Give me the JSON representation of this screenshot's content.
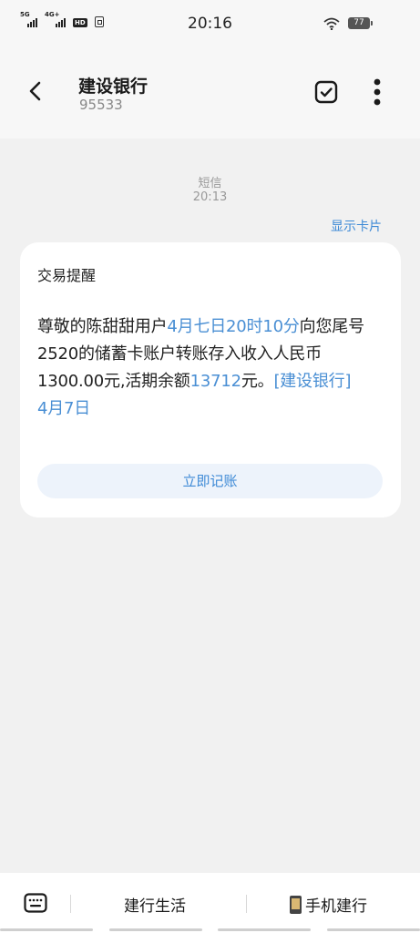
{
  "status_bar": {
    "signal_1": "5G",
    "signal_2": "4G+",
    "hd_badge": "HD",
    "time": "20:16",
    "battery": "77"
  },
  "header": {
    "title": "建设银行",
    "number": "95533"
  },
  "message": {
    "channel": "短信",
    "time": "20:13",
    "show_card_label": "显示卡片",
    "card_title": "交易提醒",
    "body": {
      "p1": "尊敬的陈甜甜用户",
      "p2": "4月七日20时10分",
      "p3": "向您尾号2520的储蓄卡账户转账存入收入人民币1300.00元,活期余额",
      "p4": "13712",
      "p5": "元。",
      "p6": "[建设银行]"
    },
    "date": "4月7日",
    "record_button": "立即记账"
  },
  "bottom_bar": {
    "menu_1": "建行生活",
    "menu_2": "手机建行"
  }
}
